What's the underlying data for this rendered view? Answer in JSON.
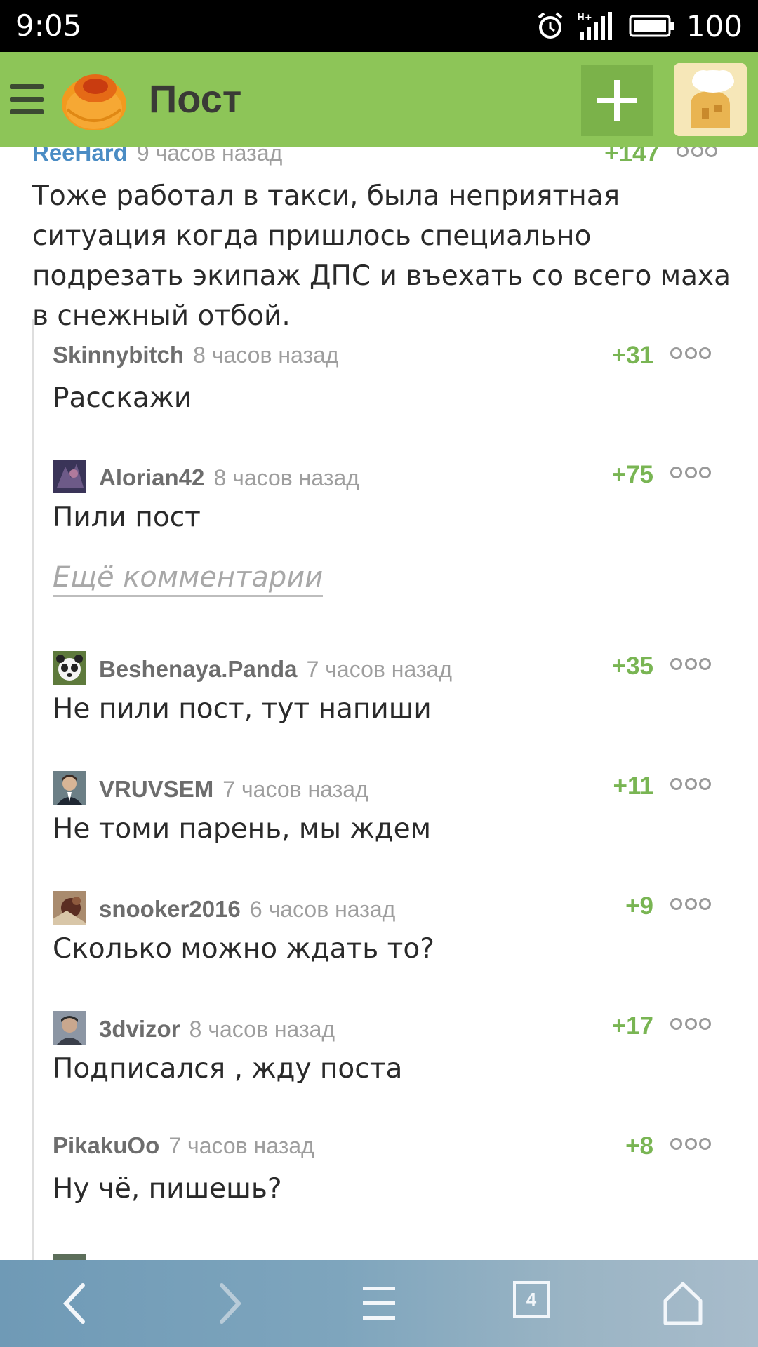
{
  "status_bar": {
    "time": "9:05",
    "battery": "100",
    "icons": [
      "alarm-icon",
      "signal-icon",
      "battery-icon"
    ]
  },
  "app_bar": {
    "title": "Пост",
    "icons": [
      "menu-icon",
      "logo-icon",
      "add-icon",
      "profile-avatar"
    ]
  },
  "post_comment": {
    "author": "ReeHard",
    "time": "9 часов назад",
    "rating": "+147",
    "text": "Тоже работал в такси, была неприятная ситуация когда пришлось специально подрезать экипаж ДПС и въехать со всего маха в снежный отбой."
  },
  "replies": [
    {
      "author": "Skinnybitch",
      "time": "8 часов назад",
      "rating": "+31",
      "text": "Расскажи"
    },
    {
      "author": "Alorian42",
      "time": "8 часов назад",
      "rating": "+75",
      "text": "Пили пост"
    },
    {
      "author": "Beshenaya.Panda",
      "time": "7 часов назад",
      "rating": "+35",
      "text": "Не пили пост, тут напиши"
    },
    {
      "author": "VRUVSEM",
      "time": "7 часов назад",
      "rating": "+11",
      "text": "Не томи парень, мы ждем"
    },
    {
      "author": "snooker2016",
      "time": "6 часов назад",
      "rating": "+9",
      "text": "Сколько можно ждать то?"
    },
    {
      "author": "3dvizor",
      "time": "8 часов назад",
      "rating": "+17",
      "text": "Подписался , жду поста"
    },
    {
      "author": "PikakuOo",
      "time": "7 часов назад",
      "rating": "+8",
      "text": "Ну чё, пишешь?"
    }
  ],
  "more_comments_label": "Ещё комментарии",
  "browser_bar": {
    "tabs_count": "4",
    "icons": [
      "back-icon",
      "forward-icon",
      "menu-icon",
      "tabs-icon",
      "home-icon"
    ]
  },
  "colors": {
    "accent_green": "#8dc558",
    "rating_green": "#79b553",
    "author_blue": "#4a8cc4"
  }
}
